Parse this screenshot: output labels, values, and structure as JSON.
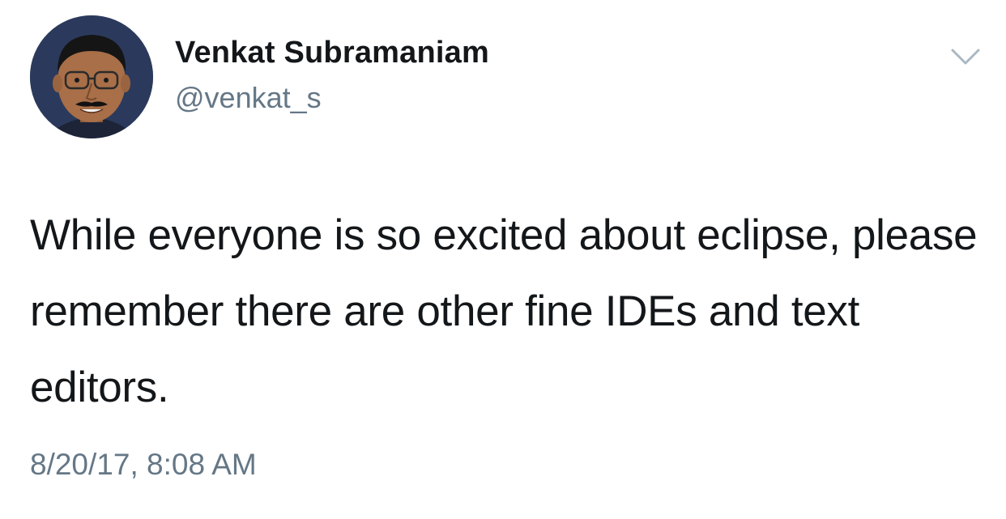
{
  "tweet": {
    "author": {
      "display_name": "Venkat Subramaniam",
      "handle": "@venkat_s",
      "avatar_icon": "profile-photo"
    },
    "menu_icon": "chevron-down-icon",
    "text": "While everyone is so excited about eclipse, please remember there are other fine IDEs and text editors.",
    "timestamp": "8/20/17, 8:08 AM"
  },
  "colors": {
    "text_primary": "#14171a",
    "text_secondary": "#657786",
    "caret": "#aab8c2",
    "background": "#ffffff"
  }
}
